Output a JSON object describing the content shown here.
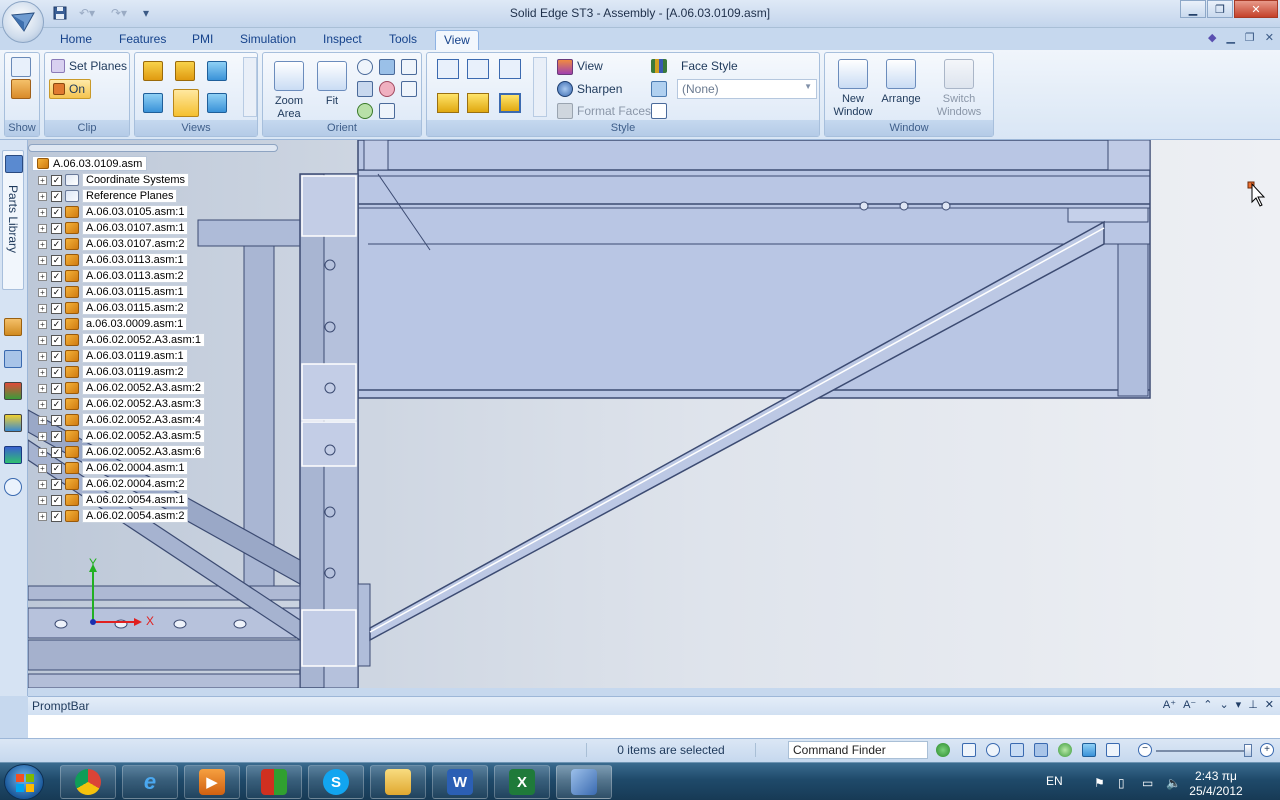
{
  "window": {
    "title": "Solid Edge ST3 - Assembly - [A.06.03.0109.asm]",
    "controls": [
      "minimize",
      "restore",
      "close"
    ]
  },
  "quick_access": {
    "icons": [
      "save-icon",
      "undo-icon",
      "redo-icon",
      "customize-icon"
    ]
  },
  "tabs": [
    "Home",
    "Features",
    "PMI",
    "Simulation",
    "Inspect",
    "Tools",
    "View"
  ],
  "active_tab": "View",
  "ribbon": {
    "groups": {
      "show": "Show",
      "clip": "Clip",
      "views": "Views",
      "orient": "Orient",
      "style": "Style",
      "window": "Window"
    },
    "clip": {
      "set_planes": "Set Planes",
      "on": "On"
    },
    "orient": {
      "zoom_area": "Zoom Area",
      "fit": "Fit"
    },
    "style": {
      "view": "View",
      "sharpen": "Sharpen",
      "format_faces": "Format Faces",
      "face_style_label": "Face Style",
      "face_style_value": "(None)"
    },
    "window": {
      "new_window": "New Window",
      "arrange": "Arrange",
      "switch_windows": "Switch Windows"
    }
  },
  "dock": {
    "parts_library": "Parts Library"
  },
  "pathfinder": {
    "root": "A.06.03.0109.asm",
    "items": [
      {
        "label": "Coordinate Systems",
        "type": "coord"
      },
      {
        "label": "Reference Planes",
        "type": "planes"
      },
      {
        "label": "A.06.03.0105.asm:1",
        "type": "asm"
      },
      {
        "label": "A.06.03.0107.asm:1",
        "type": "asm"
      },
      {
        "label": "A.06.03.0107.asm:2",
        "type": "asm"
      },
      {
        "label": "A.06.03.0113.asm:1",
        "type": "asm"
      },
      {
        "label": "A.06.03.0113.asm:2",
        "type": "asm"
      },
      {
        "label": "A.06.03.0115.asm:1",
        "type": "asm"
      },
      {
        "label": "A.06.03.0115.asm:2",
        "type": "asm"
      },
      {
        "label": "a.06.03.0009.asm:1",
        "type": "asm"
      },
      {
        "label": "A.06.02.0052.A3.asm:1",
        "type": "asm"
      },
      {
        "label": "A.06.03.0119.asm:1",
        "type": "asm"
      },
      {
        "label": "A.06.03.0119.asm:2",
        "type": "asm"
      },
      {
        "label": "A.06.02.0052.A3.asm:2",
        "type": "asm"
      },
      {
        "label": "A.06.02.0052.A3.asm:3",
        "type": "asm"
      },
      {
        "label": "A.06.02.0052.A3.asm:4",
        "type": "asm"
      },
      {
        "label": "A.06.02.0052.A3.asm:5",
        "type": "asm"
      },
      {
        "label": "A.06.02.0052.A3.asm:6",
        "type": "asm"
      },
      {
        "label": "A.06.02.0004.asm:1",
        "type": "asm"
      },
      {
        "label": "A.06.02.0004.asm:2",
        "type": "asm"
      },
      {
        "label": "A.06.02.0054.asm:1",
        "type": "asm"
      },
      {
        "label": "A.06.02.0054.asm:2",
        "type": "asm"
      }
    ]
  },
  "triad": {
    "x": "X",
    "y": "Y"
  },
  "promptbar": {
    "title": "PromptBar"
  },
  "status": {
    "selection": "0 items are selected",
    "command_finder": "Command Finder"
  },
  "taskbar": {
    "apps": [
      "chrome",
      "internet-explorer",
      "media-player",
      "app-red-green",
      "skype",
      "file-explorer",
      "word",
      "excel",
      "solid-edge"
    ],
    "language": "EN",
    "time": "2:43 πμ",
    "date": "25/4/2012"
  },
  "colors": {
    "ribbon_bg": "#dbe7f6",
    "accent": "#15428b",
    "model_fill": "#b9c6e4",
    "model_edge": "#3c4b72",
    "background_left": "#bdc8d8",
    "background_right": "#eef0f4",
    "taskbar": "#1f4a6a"
  }
}
